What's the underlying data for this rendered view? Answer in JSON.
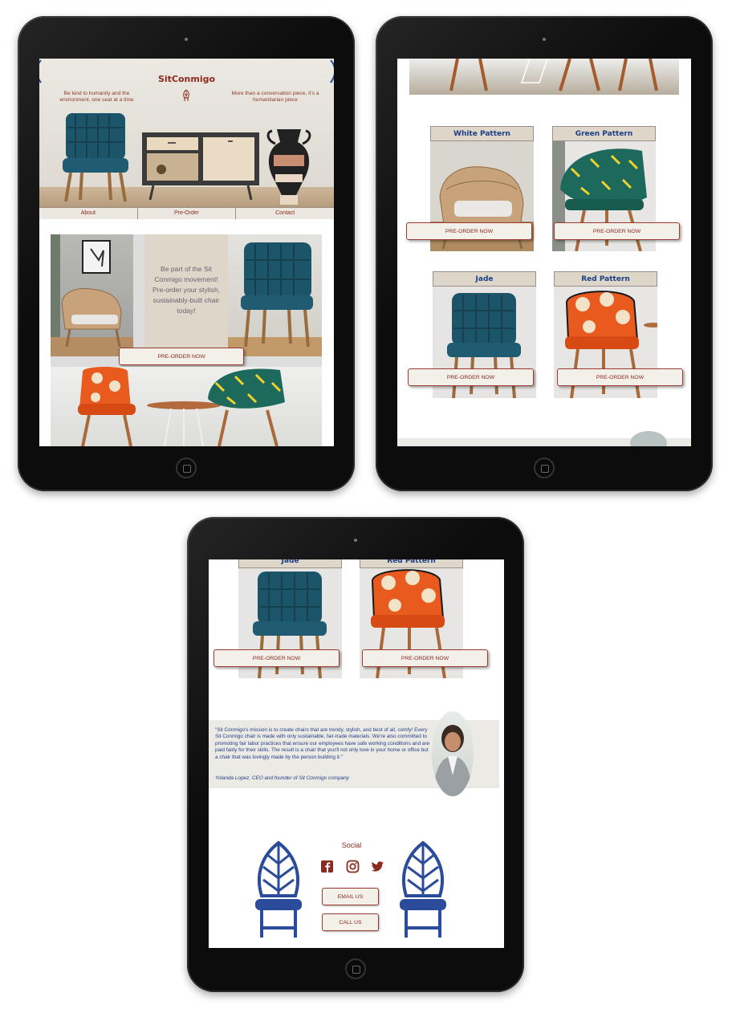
{
  "brand": {
    "name": "SitConmigo",
    "accent": "#8b2a1f",
    "blue": "#1c3f86"
  },
  "hero": {
    "tagline_left": "Be kind to humanity and the environment, one seat at a time",
    "tagline_right": "More than a conversation piece, it's a humanitarian piece"
  },
  "nav": [
    "About",
    "Pre-Order",
    "Contact"
  ],
  "promo": {
    "text": "Be part of the Sit Conmigo movement! Pre-order your stylish, sustainably-built chair today!",
    "button": "PRE-ORDER NOW"
  },
  "products": [
    {
      "name": "White Pattern",
      "button": "PRE-ORDER NOW"
    },
    {
      "name": "Green Pattern",
      "button": "PRE-ORDER NOW"
    },
    {
      "name": "Jade",
      "button": "PRE-ORDER NOW"
    },
    {
      "name": "Red Pattern",
      "button": "PRE-ORDER NOW"
    }
  ],
  "quote": {
    "text": "\"Sit Conmigo's mission is to create chairs that are trendy, stylish, and best of all, comfy! Every Sit Conmigo chair is made with only sustainable, fair-trade materials. We're also committed to promoting fair labor practices that ensure our employees have safe working conditions and are paid fairly for their skills. The result is a chair that you'll not only love in your home or office but a chair that was lovingly made by the person building it.\"",
    "author": "Yolanda Lopez, CEO and founder of Sit Conmigo company"
  },
  "footer": {
    "social_title": "Social",
    "icons": [
      "facebook-icon",
      "instagram-icon",
      "twitter-icon"
    ],
    "email_button": "EMAIL US",
    "call_button": "CALL US"
  }
}
